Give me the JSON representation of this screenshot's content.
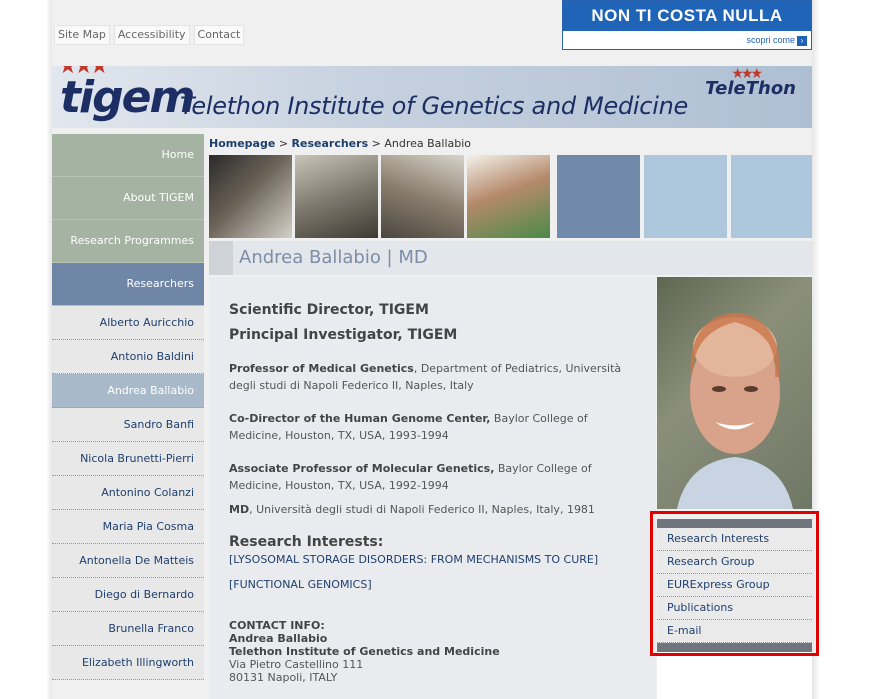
{
  "toplinks": {
    "sitemap": "Site Map",
    "accessibility": "Accessibility",
    "contact": "Contact"
  },
  "ad": {
    "headline": "NON TI COSTA NULLA",
    "link": "scopri come"
  },
  "banner": {
    "logo": "tigem",
    "title": "Telethon Institute of Genetics and Medicine",
    "telethon": "eleThon"
  },
  "nav": {
    "top": [
      "Home",
      "About TIGEM",
      "Research Programmes",
      "Researchers"
    ],
    "sub": [
      "Alberto Auricchio",
      "Antonio Baldini",
      "Andrea Ballabio",
      "Sandro Banfi",
      "Nicola Brunetti-Pierri",
      "Antonino Colanzi",
      "Maria Pia Cosma",
      "Antonella De Matteis",
      "Diego di Bernardo",
      "Brunella Franco",
      "Elizabeth Illingworth"
    ]
  },
  "breadcrumb": {
    "home": "Homepage",
    "sep1": " > ",
    "researchers": "Researchers",
    "sep2": " > ",
    "current": "Andrea Ballabio"
  },
  "page_title": "Andrea Ballabio | MD",
  "profile": {
    "role1": "Scientific Director, TIGEM",
    "role2": "Principal Investigator, TIGEM",
    "p1_bold": "Professor of Medical Genetics",
    "p1_rest": ", Department of Pediatrics, Università degli studi di Napoli Federico II, Naples, Italy",
    "p2_bold": "Co-Director of the Human Genome Center,",
    "p2_rest": " Baylor College of Medicine, Houston, TX, USA, 1993-1994",
    "p3_bold": "Associate Professor of Molecular Genetics,",
    "p3_rest": " Baylor College of Medicine, Houston, TX, USA, 1992-1994",
    "p4_bold": "MD",
    "p4_rest": ", Università degli studi di Napoli Federico II, Naples, Italy, 1981",
    "ri_heading": "Research Interests:",
    "ri1": "[LYSOSOMAL STORAGE DISORDERS: FROM MECHANISMS TO CURE]",
    "ri2": "[FUNCTIONAL GENOMICS]",
    "contact_heading": "CONTACT INFO:",
    "contact_name": "Andrea Ballabio",
    "contact_inst": "Telethon Institute of Genetics and Medicine",
    "contact_addr1": "Via Pietro Castellino 111",
    "contact_addr2": "80131 Napoli, ITALY"
  },
  "side_menu": [
    "Research Interests",
    "Research Group",
    "EURExpress Group",
    "Publications",
    "E-mail"
  ],
  "colors": {
    "nav_green": "#a4b3a2",
    "nav_active": "#6f86a6",
    "link": "#1d3f6e",
    "highlight": "#e00000"
  }
}
